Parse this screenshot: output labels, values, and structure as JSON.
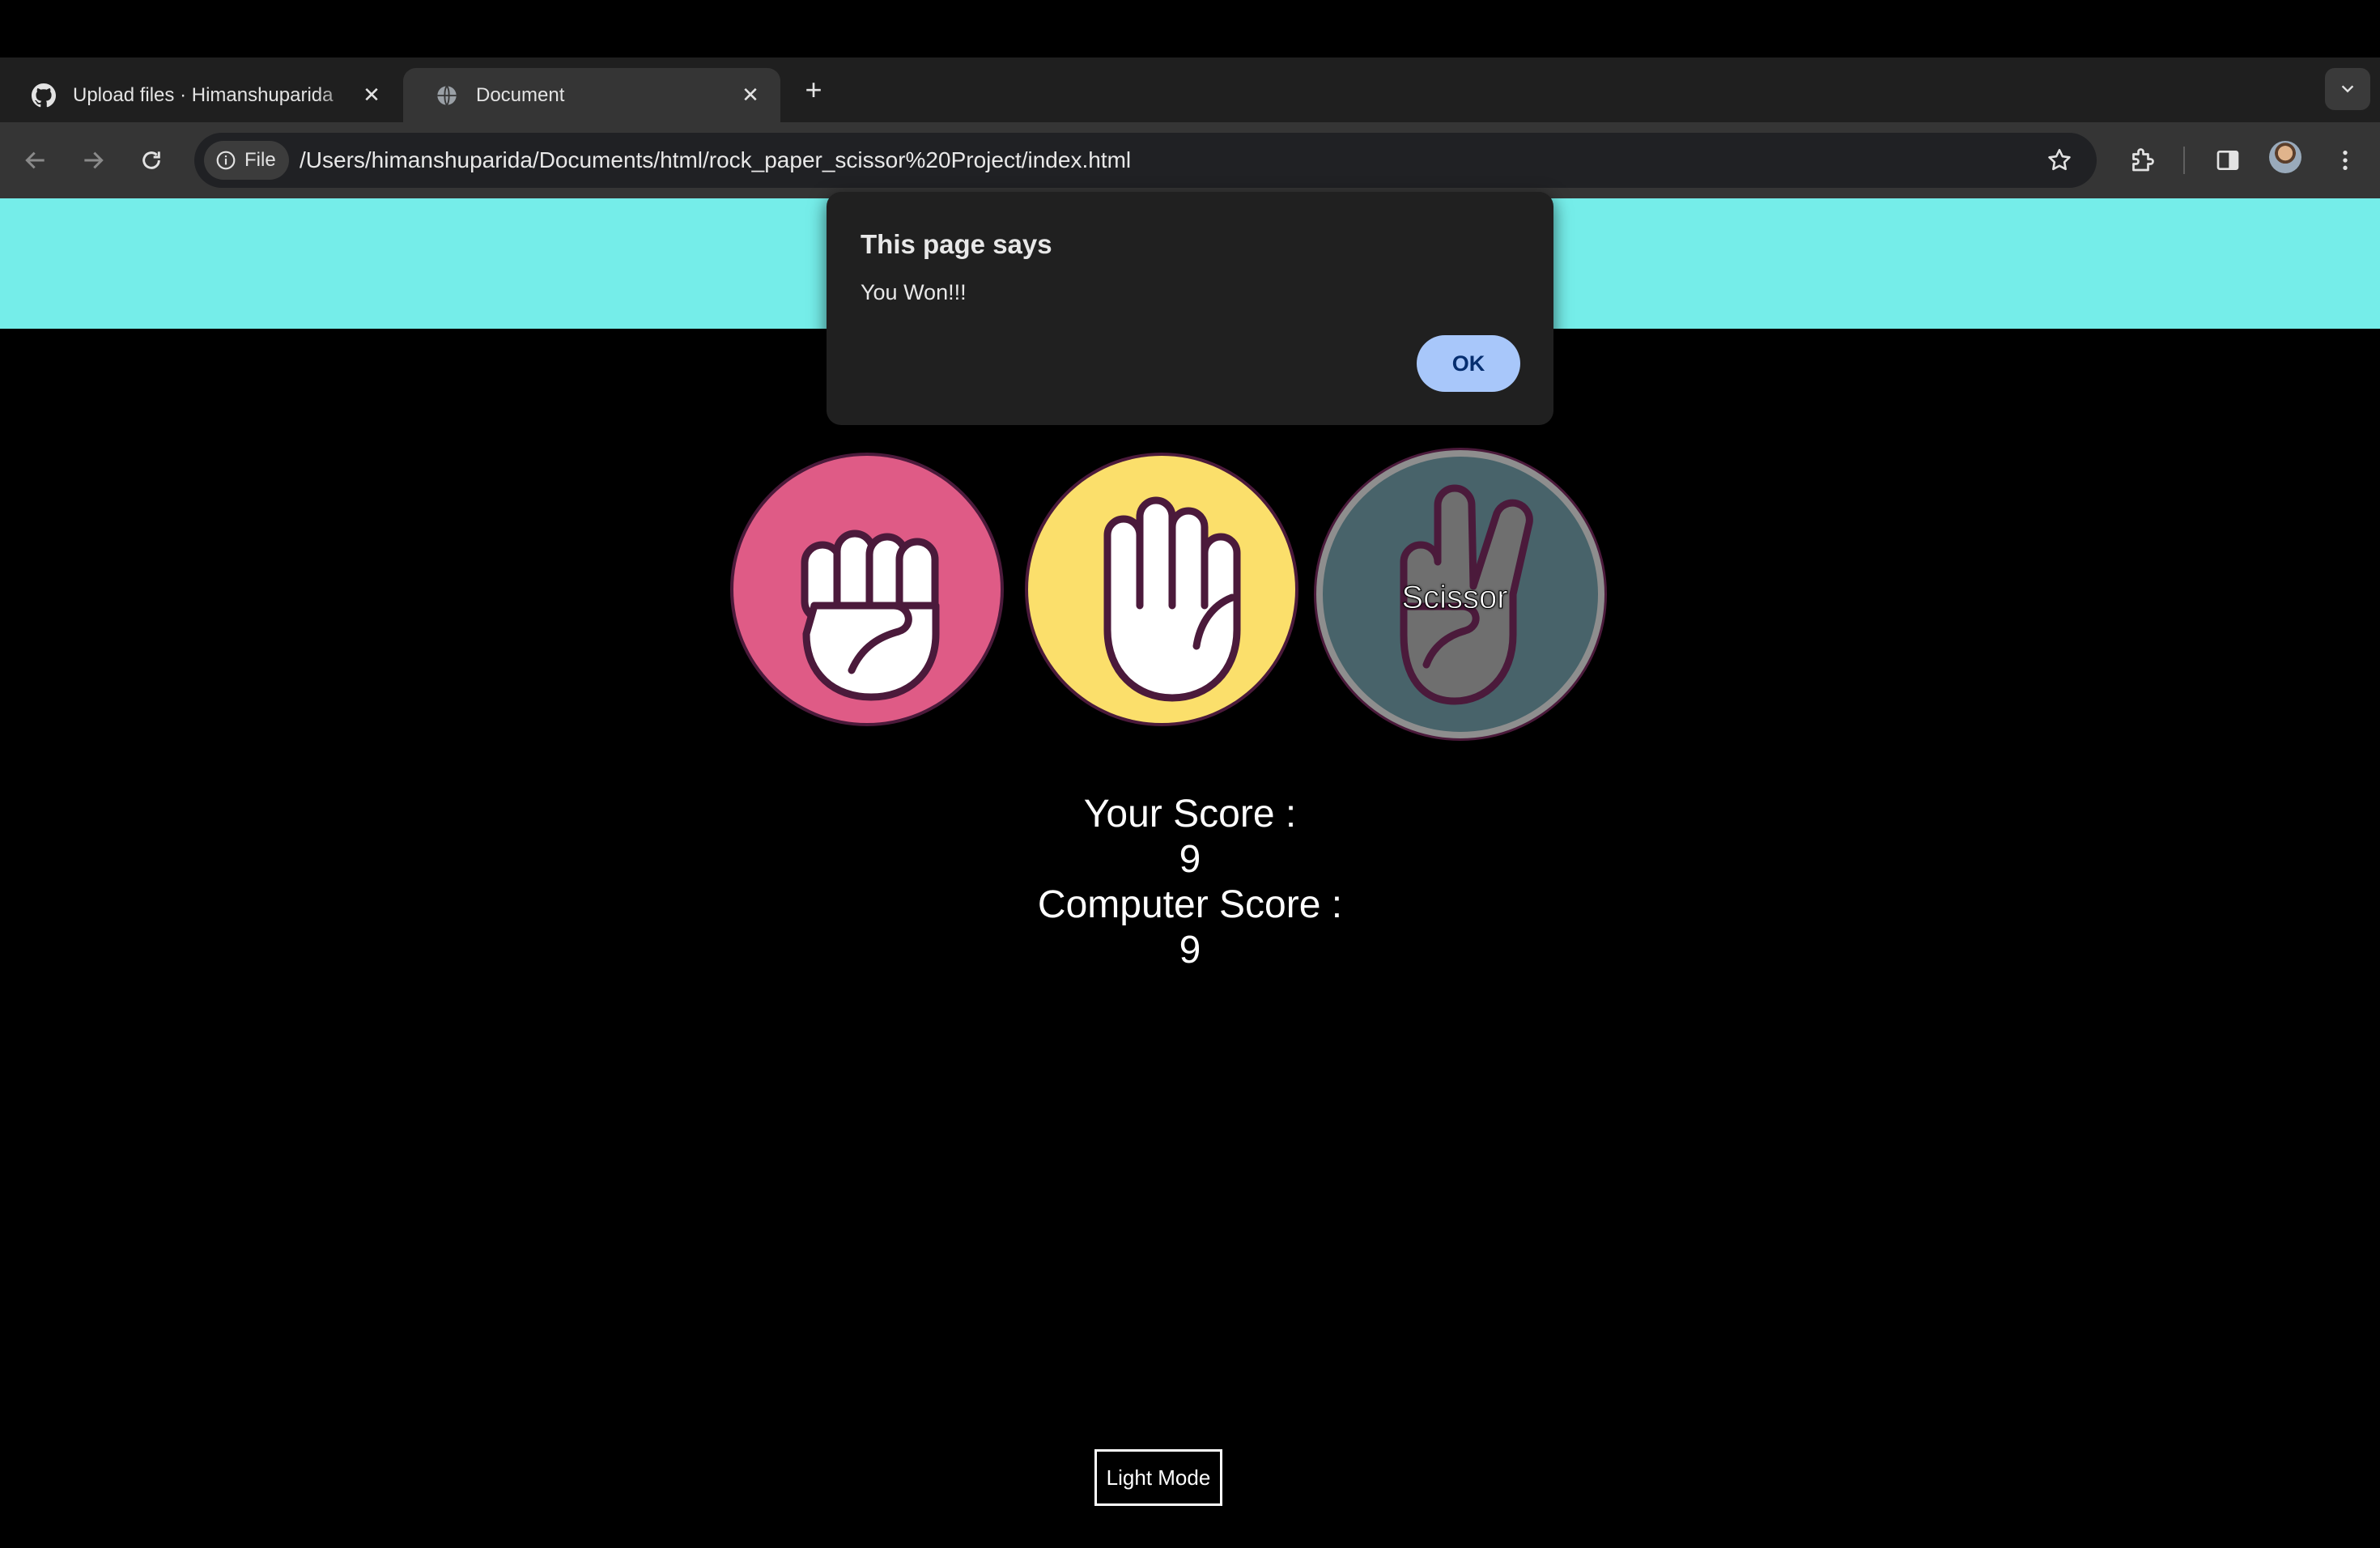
{
  "browser": {
    "tabs": [
      {
        "title": "Upload files · Himanshuparida",
        "favicon": "github-icon",
        "active": false
      },
      {
        "title": "Document",
        "favicon": "globe-icon",
        "active": true
      }
    ],
    "address_bar": {
      "scheme_chip": "File",
      "url": "/Users/himanshuparida/Documents/html/rock_paper_scissor%20Project/index.html"
    }
  },
  "alert": {
    "title": "This page says",
    "message": "You Won!!!",
    "ok_label": "OK"
  },
  "game": {
    "choices": [
      {
        "name": "rock",
        "color": "#df5b86"
      },
      {
        "name": "paper",
        "color": "#fbdf6b"
      },
      {
        "name": "scissor",
        "color": "#48636a",
        "label": "Scissor"
      }
    ],
    "user_score_label": "Your Score :",
    "user_score": "9",
    "computer_score_label": "Computer Score :",
    "computer_score": "9"
  },
  "theme_toggle_label": "Light Mode",
  "colors": {
    "header": "#75ede9",
    "page_background": "#000000",
    "ok_button": "#a8c7fa"
  }
}
